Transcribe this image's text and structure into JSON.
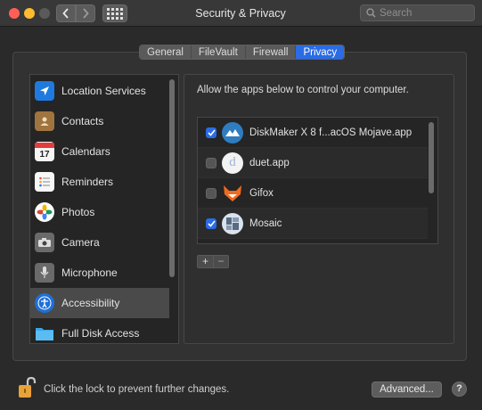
{
  "window": {
    "title": "Security & Privacy",
    "search_placeholder": "Search"
  },
  "tabs": [
    {
      "label": "General",
      "active": false
    },
    {
      "label": "FileVault",
      "active": false
    },
    {
      "label": "Firewall",
      "active": false
    },
    {
      "label": "Privacy",
      "active": true
    }
  ],
  "sidebar": {
    "items": [
      {
        "label": "Location Services",
        "icon": "location-arrow-icon",
        "selected": false
      },
      {
        "label": "Contacts",
        "icon": "contacts-book-icon",
        "selected": false
      },
      {
        "label": "Calendars",
        "icon": "calendar-icon",
        "selected": false,
        "icon_text": "17"
      },
      {
        "label": "Reminders",
        "icon": "reminders-list-icon",
        "selected": false
      },
      {
        "label": "Photos",
        "icon": "photos-flower-icon",
        "selected": false
      },
      {
        "label": "Camera",
        "icon": "camera-icon",
        "selected": false
      },
      {
        "label": "Microphone",
        "icon": "microphone-icon",
        "selected": false
      },
      {
        "label": "Accessibility",
        "icon": "accessibility-icon",
        "selected": true
      },
      {
        "label": "Full Disk Access",
        "icon": "folder-icon",
        "selected": false
      }
    ]
  },
  "privacy": {
    "description": "Allow the apps below to control your computer.",
    "apps": [
      {
        "name": "DiskMaker X 8 f...acOS Mojave.app",
        "checked": true,
        "icon": "diskmaker-app-icon"
      },
      {
        "name": "duet.app",
        "checked": false,
        "icon": "duet-app-icon",
        "icon_text": "d"
      },
      {
        "name": "Gifox",
        "checked": false,
        "icon": "gifox-fox-icon"
      },
      {
        "name": "Mosaic",
        "checked": true,
        "icon": "mosaic-app-icon"
      }
    ],
    "add_label": "+",
    "remove_label": "−"
  },
  "footer": {
    "lock_text": "Click the lock to prevent further changes.",
    "advanced_label": "Advanced...",
    "help_label": "?"
  },
  "colors": {
    "accent": "#2a6ce5",
    "window_bg": "#2a2a2a",
    "lock": "#e8a23a"
  }
}
